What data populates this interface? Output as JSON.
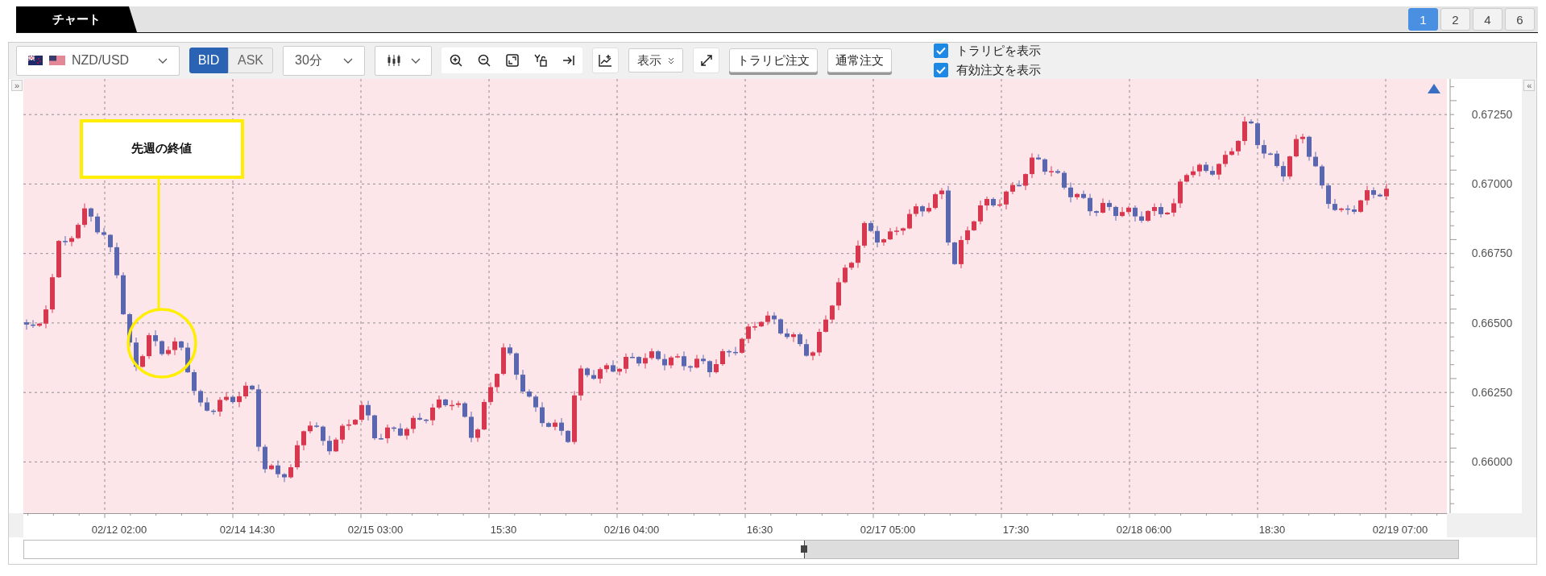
{
  "tabs": [
    {
      "label": "チャート",
      "selected": true
    }
  ],
  "layout_buttons": [
    {
      "label": "1",
      "selected": true
    },
    {
      "label": "2",
      "selected": false
    },
    {
      "label": "4",
      "selected": false
    },
    {
      "label": "6",
      "selected": false
    }
  ],
  "toolbar": {
    "pair": "NZD/USD",
    "price_sides": [
      {
        "label": "BID",
        "selected": true
      },
      {
        "label": "ASK",
        "selected": false
      }
    ],
    "timeframe": "30分",
    "display": "表示",
    "order_buttons": [
      "トラリピ注文",
      "通常注文"
    ],
    "checkboxes": [
      {
        "label": "トラリピを表示",
        "checked": true
      },
      {
        "label": "有効注文を表示",
        "checked": true
      }
    ]
  },
  "chart": {
    "left_toggle": "»",
    "right_toggle": "«",
    "annotation": "先週の終値",
    "y_labels": [
      "0.67250",
      "0.67000",
      "0.66750",
      "0.66500",
      "0.66250",
      "0.66000"
    ],
    "x_labels": [
      "02/12 02:00",
      "02/14 14:30",
      "02/15 03:00",
      "15:30",
      "02/16 04:00",
      "16:30",
      "02/17 05:00",
      "17:30",
      "02/18 06:00",
      "18:30",
      "02/19 07:00"
    ]
  }
}
